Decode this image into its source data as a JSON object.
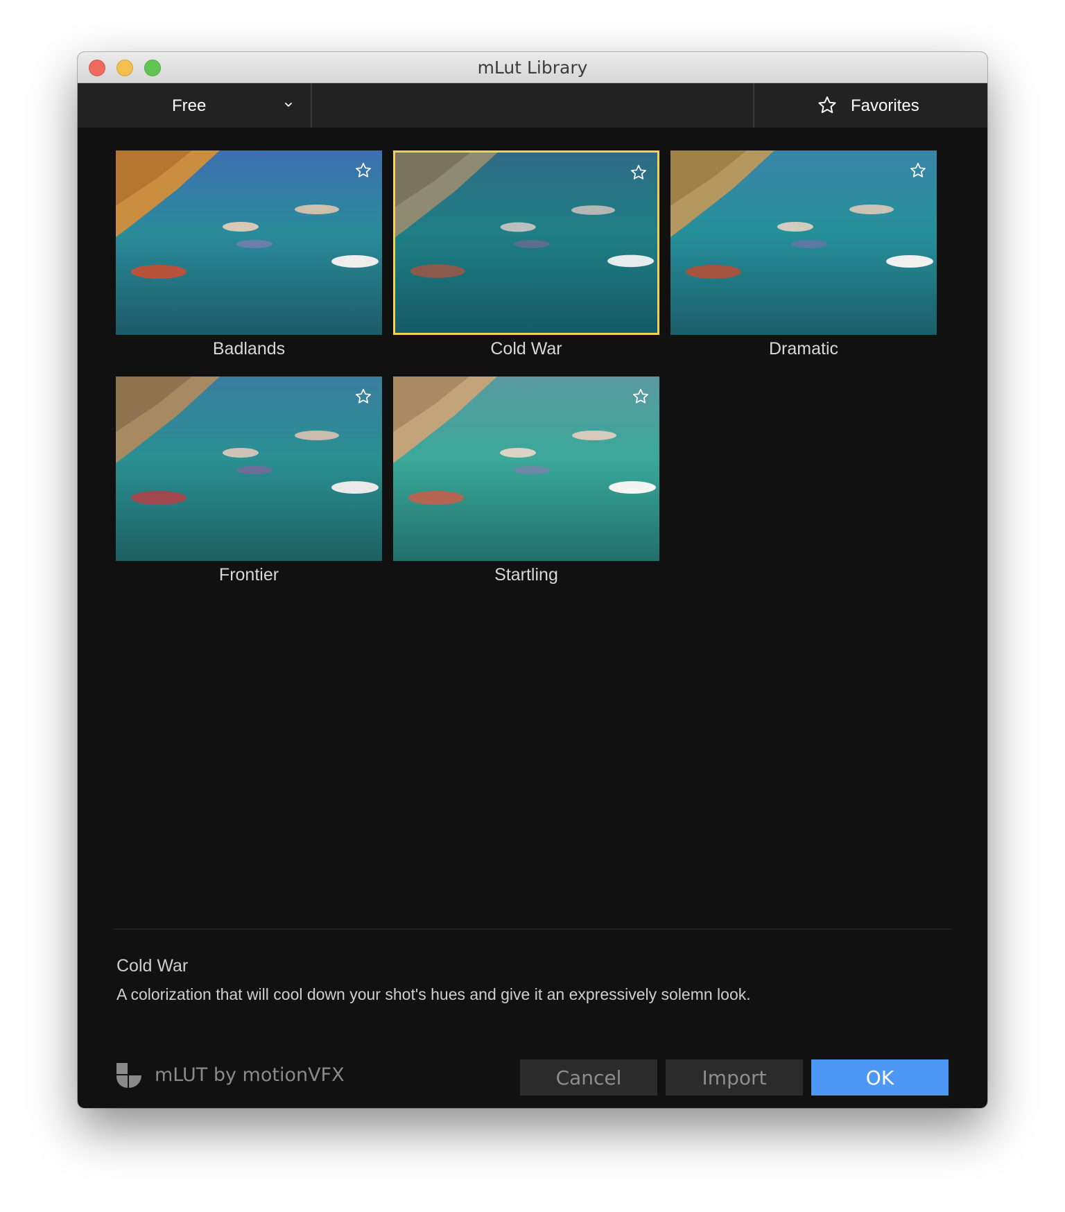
{
  "window": {
    "title": "mLut Library"
  },
  "toolbar": {
    "category_selected": "Free",
    "favorites_label": "Favorites"
  },
  "luts": [
    {
      "name": "Badlands",
      "selected": false,
      "favorite": false
    },
    {
      "name": "Cold War",
      "selected": true,
      "favorite": false
    },
    {
      "name": "Dramatic",
      "selected": false,
      "favorite": false
    },
    {
      "name": "Frontier",
      "selected": false,
      "favorite": false
    },
    {
      "name": "Startling",
      "selected": false,
      "favorite": false
    }
  ],
  "description": {
    "title": "Cold War",
    "text": "A colorization that will cool down your shot's hues and give it an expressively solemn look."
  },
  "footer": {
    "brand": "mLUT by motionVFX",
    "cancel_label": "Cancel",
    "import_label": "Import",
    "ok_label": "OK"
  },
  "colors": {
    "accent": "#4e98f5",
    "selection_border": "#f2d34a",
    "background": "#111111",
    "toolbar": "#222222"
  },
  "icons": {
    "dropdown": "chevron-down-icon",
    "favorites": "star-outline-icon",
    "thumb_favorite": "star-outline-icon",
    "brand": "mlut-logo-icon"
  }
}
